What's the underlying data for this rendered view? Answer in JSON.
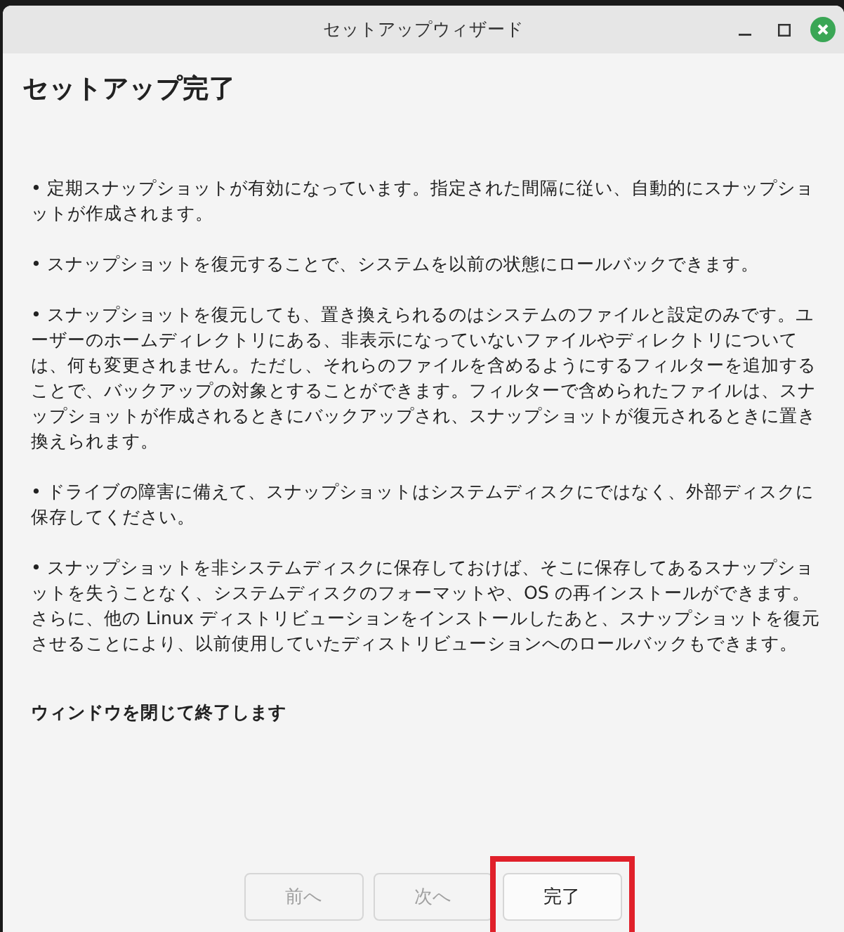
{
  "window": {
    "title": "セットアップウィザード"
  },
  "heading": "セットアップ完了",
  "paragraphs": [
    "• 定期スナップショットが有効になっています。指定された間隔に従い、自動的にスナップショットが作成されます。",
    "• スナップショットを復元することで、システムを以前の状態にロールバックできます。",
    "• スナップショットを復元しても、置き換えられるのはシステムのファイルと設定のみです。ユーザーのホームディレクトリにある、非表示になっていないファイルやディレクトリについては、何も変更されません。ただし、それらのファイルを含めるようにするフィルターを追加することで、バックアップの対象とすることができます。フィルターで含められたファイルは、スナップショットが作成されるときにバックアップされ、スナップショットが復元されるときに置き換えられます。",
    "• ドライブの障害に備えて、スナップショットはシステムディスクにではなく、外部ディスクに保存してください。",
    "• スナップショットを非システムディスクに保存しておけば、そこに保存してあるスナップショットを失うことなく、システムディスクのフォーマットや、OS の再インストールができます。さらに、他の Linux ディストリビューションをインストールしたあと、スナップショットを復元させることにより、以前使用していたディストリビューションへのロールバックもできます。"
  ],
  "closing_note": "ウィンドウを閉じて終了します",
  "buttons": [
    {
      "label": "前へ",
      "disabled": true,
      "highlighted": false
    },
    {
      "label": "次へ",
      "disabled": true,
      "highlighted": false
    },
    {
      "label": "完了",
      "disabled": false,
      "highlighted": true
    }
  ]
}
